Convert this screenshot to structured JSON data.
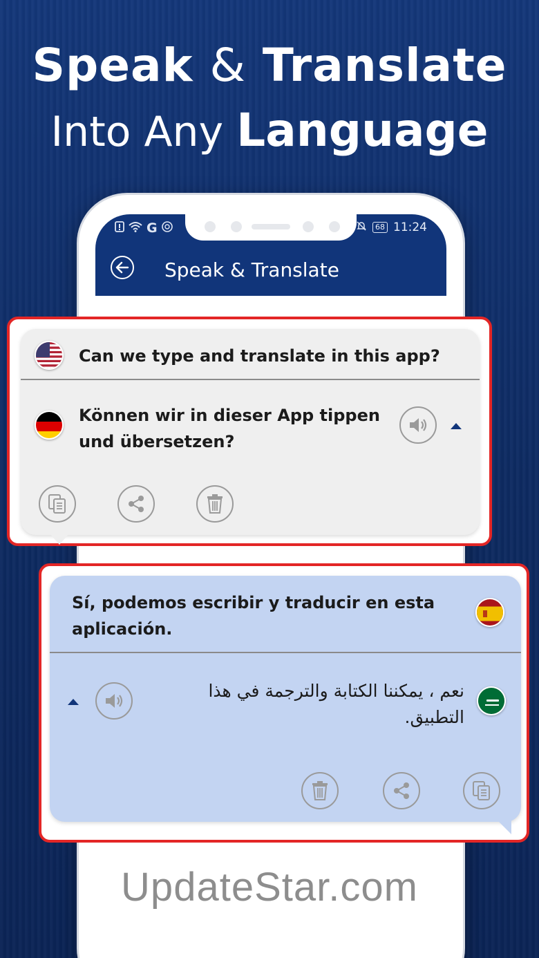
{
  "hero": {
    "line1_word1": "Speak",
    "line1_amp": "&",
    "line1_word2": "Translate",
    "line2_light": "Into Any",
    "line2_bold": "Language"
  },
  "statusbar": {
    "left_icons": [
      "alert-icon",
      "wifi-icon",
      "google-icon",
      "data-icon"
    ],
    "google": "G",
    "battery": "68",
    "time": "11:24"
  },
  "appbar": {
    "title": "Speak & Translate"
  },
  "card1": {
    "source_lang_flag": "us-flag",
    "source_text": "Can we type and translate in this app?",
    "target_lang_flag": "de-flag",
    "target_text_line1": "Können wir in dieser App tippen",
    "target_text_line2": "und übersetzen?",
    "actions": [
      "copy-icon",
      "share-icon",
      "delete-icon"
    ]
  },
  "card2": {
    "source_lang_flag": "es-flag",
    "source_text_line1": "Sí, podemos escribir y traducir en esta",
    "source_text_line2": "aplicación.",
    "target_lang_flag": "sa-flag",
    "target_text_line1": "نعم ، يمكننا الكتابة والترجمة في هذا",
    "target_text_line2": "التطبيق.",
    "actions": [
      "delete-icon",
      "share-icon",
      "copy-icon"
    ]
  },
  "colors": {
    "accent": "#11357a",
    "highlight_border": "#e32626",
    "bubble_grey": "#efefef",
    "bubble_blue": "#c3d4f2"
  },
  "watermark": "UpdateStar.com"
}
